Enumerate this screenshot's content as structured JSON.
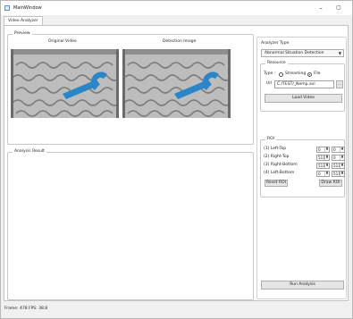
{
  "window": {
    "title": "MainWindow",
    "minimize_glyph": "–",
    "maximize_glyph": "▢"
  },
  "tabs": [
    {
      "label": "Video Analyzer"
    }
  ],
  "preview": {
    "group_title": "Preview",
    "original_label": "Original Video",
    "detection_label": "Detection Image"
  },
  "analysis_result": {
    "group_title": "Analysis Result"
  },
  "analyzer_type": {
    "title": "Analyzer Type",
    "selected": "Abnormal Situation Detection"
  },
  "resource": {
    "title": "Resource",
    "type_label": "Type :",
    "option_streaming": "Streaming",
    "option_file": "File",
    "selected_option": "File",
    "url_label": "Url",
    "url_value": "C:/TEST/_Nemp.avi",
    "browse_label": "...",
    "load_button": "Load Video"
  },
  "roi": {
    "title": "ROI",
    "rows": [
      {
        "label": "(1) Left-Top",
        "x": "0",
        "y": "0"
      },
      {
        "label": "(2) Right-Top",
        "x": "511",
        "y": "0"
      },
      {
        "label": "(3) Right-Bottom",
        "x": "511",
        "y": "511"
      },
      {
        "label": "(4) Left-Bottom",
        "x": "0",
        "y": "511"
      }
    ],
    "reset_button": "Reset ROI",
    "draw_button": "Draw ROI"
  },
  "run_button": "Run Analysis",
  "status": {
    "text": "Frame: 478 FPS: 38.8"
  },
  "icons": {
    "window_icon": "app-window-icon",
    "dropdown": "chevron-down-icon",
    "spin": "spin-arrows-icon"
  },
  "colors": {
    "wrench": "#2a86c6",
    "belt": "#c9c9c9"
  }
}
